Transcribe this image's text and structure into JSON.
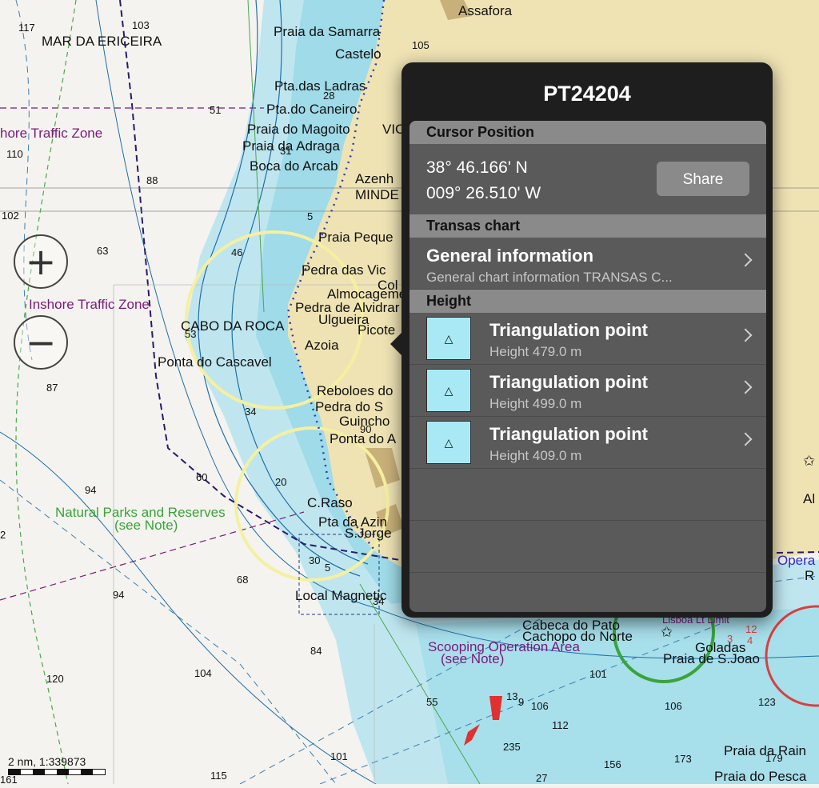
{
  "map": {
    "places": [
      {
        "id": "assafora",
        "text": "Assafora"
      },
      {
        "id": "samarra",
        "text": "Praia da Samarra"
      },
      {
        "id": "castelo",
        "text": "Castelo"
      },
      {
        "id": "ladras",
        "text": "Pta.das Ladras"
      },
      {
        "id": "caneiro",
        "text": "Pta.do Caneiro"
      },
      {
        "id": "magoito",
        "text": "Praia do Magoito"
      },
      {
        "id": "adraga",
        "text": "Praia da Adraga"
      },
      {
        "id": "arcab",
        "text": "Boca do Arcab"
      },
      {
        "id": "praiapeq",
        "text": "Praia Peque"
      },
      {
        "id": "pedravic",
        "text": "Pedra das Vic"
      },
      {
        "id": "almocageme",
        "text": "Almocageme"
      },
      {
        "id": "alvidrar",
        "text": "Pedra de Alvidrar"
      },
      {
        "id": "ulgueira",
        "text": "Ulgueira"
      },
      {
        "id": "roca",
        "text": "CABO DA ROCA"
      },
      {
        "id": "azoia",
        "text": "Azoia"
      },
      {
        "id": "cascavel",
        "text": "Ponta do Cascavel"
      },
      {
        "id": "reboloes",
        "text": "Reboloes do"
      },
      {
        "id": "pedradoS",
        "text": "Pedra do S"
      },
      {
        "id": "guincho",
        "text": "Guincho"
      },
      {
        "id": "pontada",
        "text": "Ponta do A"
      },
      {
        "id": "craso",
        "text": "C.Raso"
      },
      {
        "id": "azin",
        "text": "Pta da Azin"
      },
      {
        "id": "sjorge",
        "text": "S.Jorge"
      },
      {
        "id": "magnetic",
        "text": "Local Magnetic"
      },
      {
        "id": "cabeca",
        "text": "Cabeca do Pato"
      },
      {
        "id": "cachopo",
        "text": "Cachopo do Norte"
      },
      {
        "id": "goladas",
        "text": "Goladas"
      },
      {
        "id": "sjoao",
        "text": "Praia de S.Joao"
      },
      {
        "id": "rain",
        "text": "Praia da Rain"
      },
      {
        "id": "pesca",
        "text": "Praia do Pesca"
      },
      {
        "id": "ericeira",
        "text": "MAR DA ERICEIRA"
      },
      {
        "id": "picote",
        "text": "Picote"
      },
      {
        "id": "azenh",
        "text": "Azenh"
      },
      {
        "id": "minde",
        "text": "MINDE"
      },
      {
        "id": "col",
        "text": "Col"
      },
      {
        "id": "vic",
        "text": "VIC"
      },
      {
        "id": "al",
        "text": "Al"
      },
      {
        "id": "r",
        "text": "R"
      }
    ],
    "zones": [
      {
        "id": "inshore1",
        "text": "hore Traffic Zone"
      },
      {
        "id": "inshore2",
        "text": "Inshore Traffic Zone"
      },
      {
        "id": "scooping1",
        "text": "Scooping Operation Area"
      },
      {
        "id": "scooping2",
        "text": "(see Note)"
      },
      {
        "id": "opera",
        "text": "Opera"
      },
      {
        "id": "lisboa",
        "text": "Lisboa Lt Limit"
      }
    ],
    "green_labels": [
      {
        "id": "parks1",
        "text": "Natural Parks and Reserves"
      },
      {
        "id": "parks2",
        "text": "(see Note)"
      }
    ],
    "depths": [
      "117",
      "103",
      "105",
      "110",
      "88",
      "51",
      "28",
      "102",
      "63",
      "46",
      "31",
      "53",
      "87",
      "34",
      "60",
      "94",
      "68",
      "94",
      "84",
      "120",
      "104",
      "55",
      "101",
      "115",
      "27",
      "20",
      "30",
      "5",
      "13",
      "9",
      "106",
      "112",
      "235",
      "156",
      "173",
      "179",
      "101",
      "106",
      "123",
      "5",
      "12",
      "3",
      "4",
      "90",
      "34",
      "2",
      "161"
    ],
    "scale_text": "2 nm, 1:339873",
    "zoom_in": "+",
    "zoom_out": "−"
  },
  "popover": {
    "title": "PT24204",
    "cursor_section": "Cursor Position",
    "lat": "38° 46.166' N",
    "lon": "009° 26.510' W",
    "share": "Share",
    "chart_section": "Transas chart",
    "general_title": "General information",
    "general_sub": "General chart information TRANSAS C...",
    "height_section": "Height",
    "height_items": [
      {
        "title": "Triangulation point",
        "sub": "Height 479.0 m"
      },
      {
        "title": "Triangulation point",
        "sub": "Height 499.0 m"
      },
      {
        "title": "Triangulation point",
        "sub": "Height 409.0 m"
      }
    ],
    "icon_glyph": "△"
  }
}
